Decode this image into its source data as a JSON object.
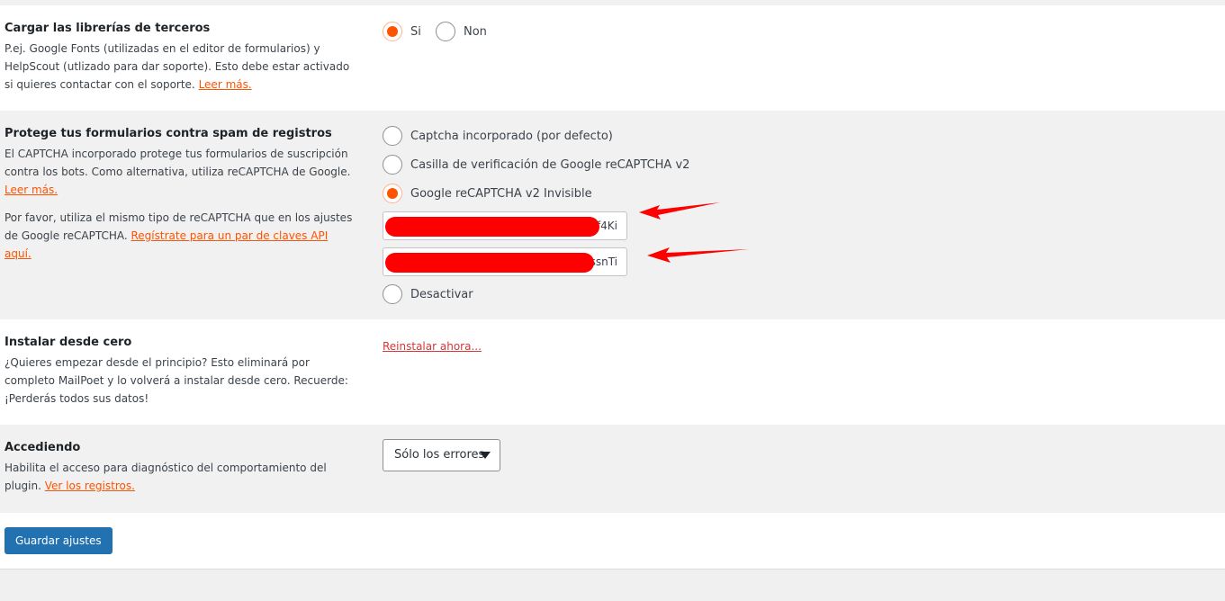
{
  "library": {
    "title": "Cargar las librerías de terceros",
    "desc": "P.ej. Google Fonts (utilizadas en el editor de formularios) y HelpScout (utlizado para dar soporte). Esto debe estar activado si quieres contactar con el soporte.",
    "link": "Leer más.",
    "options": [
      "Si",
      "Non"
    ],
    "selected": "Si"
  },
  "captcha": {
    "title": "Protege tus formularios contra spam de registros",
    "desc": "El CAPTCHA incorporado protege tus formularios de suscripción contra los bots. Como alternativa, utiliza reCAPTCHA de Google.",
    "link": "Leer más.",
    "note": "Por favor, utiliza el mismo tipo de reCAPTCHA que en los ajustes de Google reCAPTCHA.",
    "note_link": "Regístrate para un par de claves API aquí.",
    "options": [
      "Captcha incorporado (por defecto)",
      "Casilla de verificación de Google reCAPTCHA v2",
      "Google reCAPTCHA v2 Invisible",
      "Desactivar"
    ],
    "selected": "Google reCAPTCHA v2 Invisible",
    "site_key_visible": "f4Ki",
    "secret_key_visible": "ssnTi"
  },
  "reinstall": {
    "title": "Instalar desde cero",
    "desc": "¿Quieres empezar desde el principio? Esto eliminará por completo MailPoet y lo volverá a instalar desde cero. Recuerde: ¡Perderás todos sus datos!",
    "link": "Reinstalar ahora..."
  },
  "logging": {
    "title": "Accediendo",
    "desc": "Habilita el acceso para diagnóstico del comportamiento del plugin.",
    "link": "Ver los registros.",
    "select_value": "Sólo los errores"
  },
  "save_label": "Guardar ajustes",
  "colors": {
    "accent": "#ff5301",
    "button": "#2271b1",
    "annotation": "#ff0000"
  }
}
